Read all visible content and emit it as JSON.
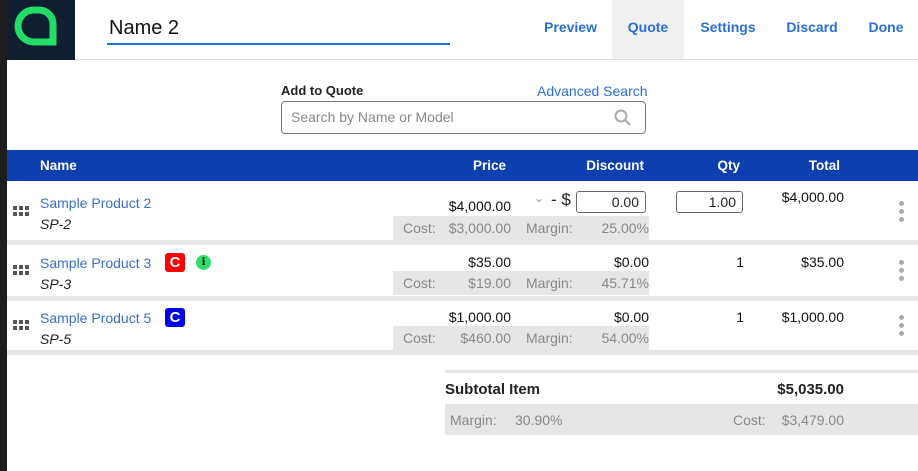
{
  "header": {
    "title": "Name 2",
    "tabs": [
      {
        "label": "Preview"
      },
      {
        "label": "Quote",
        "active": true
      },
      {
        "label": "Settings"
      },
      {
        "label": "Discard"
      },
      {
        "label": "Done"
      }
    ]
  },
  "add_to_quote": {
    "label": "Add to Quote",
    "advanced_search": "Advanced Search",
    "search_placeholder": "Search by Name or Model"
  },
  "table": {
    "columns": {
      "name": "Name",
      "price": "Price",
      "discount": "Discount",
      "qty": "Qty",
      "total": "Total"
    },
    "cost_label": "Cost:",
    "margin_label": "Margin:",
    "rows": [
      {
        "name": "Sample Product 2",
        "sku": "SP-2",
        "price": "$4,000.00",
        "discount_prefix": "- $",
        "discount": "0.00",
        "qty": "1.00",
        "total": "$4,000.00",
        "cost": "$3,000.00",
        "margin": "25.00%"
      },
      {
        "name": "Sample Product 3",
        "sku": "SP-3",
        "badge": "C",
        "badge_color": "#ff0000",
        "info": "i",
        "price": "$35.00",
        "discount": "$0.00",
        "qty": "1",
        "total": "$35.00",
        "cost": "$19.00",
        "margin": "45.71%"
      },
      {
        "name": "Sample Product 5",
        "sku": "SP-5",
        "badge": "C",
        "badge_color": "#0000ee",
        "price": "$1,000.00",
        "discount": "$0.00",
        "qty": "1",
        "total": "$1,000.00",
        "cost": "$460.00",
        "margin": "54.00%"
      }
    ]
  },
  "subtotal": {
    "label": "Subtotal Item",
    "value": "$5,035.00",
    "margin_label": "Margin:",
    "margin": "30.90%",
    "cost_label": "Cost:",
    "cost": "$3,479.00"
  },
  "colors": {
    "brand": "#22dd66",
    "accent": "#2a6fd6",
    "table_header": "#0d3fb0"
  }
}
